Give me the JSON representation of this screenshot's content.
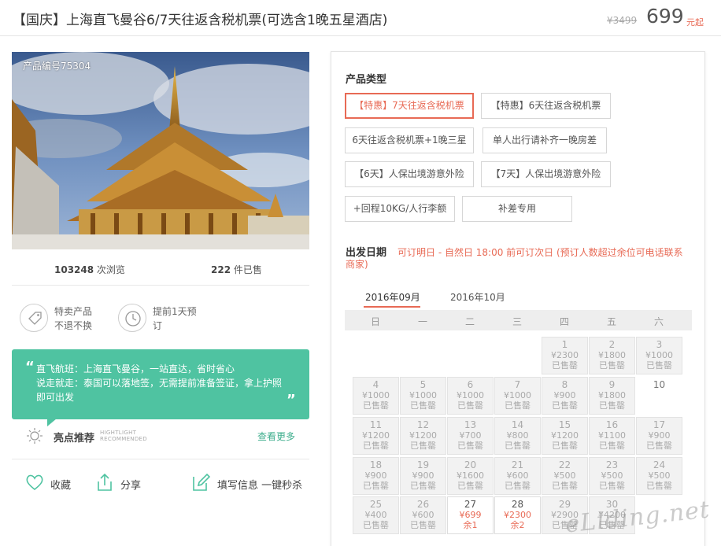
{
  "header": {
    "title": "【国庆】上海直飞曼谷6/7天往返含税机票(可选含1晚五星酒店)",
    "original_price": "¥3499",
    "price": "699",
    "price_unit": "元起"
  },
  "product": {
    "code_label": "产品编号75304",
    "views_count": "103248",
    "views_label": " 次浏览",
    "sold_count": "222",
    "sold_label": " 件已售"
  },
  "features": [
    {
      "icon": "tag-icon",
      "line1": "特卖产品",
      "line2": "不退不换"
    },
    {
      "icon": "clock-icon",
      "line1": "提前1天预",
      "line2": "订"
    }
  ],
  "highlight": {
    "lines": [
      "直飞航班：上海直飞曼谷，一站直达，省时省心",
      "说走就走：泰国可以落地签，无需提前准备签证，拿上护照",
      "即可出发"
    ],
    "label": "亮点推荐",
    "label_en_1": "HIGHTLIGHT",
    "label_en_2": "RECOMMENDED",
    "see_more": "查看更多"
  },
  "actions": {
    "favorite": "收藏",
    "share": "分享",
    "fill_info": "填写信息 一键秒杀"
  },
  "product_types": {
    "title": "产品类型",
    "options": [
      "【特惠】7天往返含税机票",
      "【特惠】6天往返含税机票",
      "6天往返含税机票+1晚三星",
      "单人出行请补齐一晚房差",
      "【6天】人保出境游意外险",
      "【7天】人保出境游意外险",
      "+回程10KG/人行李额",
      "补差专用"
    ],
    "selected_index": 0
  },
  "departure": {
    "label": "出发日期",
    "note": "可订明日 - 自然日 18:00 前可订次日    (预订人数超过余位可电话联系商家)",
    "months": [
      "2016年09月",
      "2016年10月"
    ],
    "active_month": 0,
    "weekdays": [
      "日",
      "一",
      "二",
      "三",
      "四",
      "五",
      "六"
    ],
    "sold_out_label": "已售罄"
  },
  "calendar": [
    [
      null,
      null,
      null,
      null,
      {
        "d": "1",
        "p": "¥2300",
        "s": "已售罄"
      },
      {
        "d": "2",
        "p": "¥1800",
        "s": "已售罄"
      },
      {
        "d": "3",
        "p": "¥1000",
        "s": "已售罄"
      }
    ],
    [
      {
        "d": "4",
        "p": "¥1000",
        "s": "已售罄"
      },
      {
        "d": "5",
        "p": "¥1000",
        "s": "已售罄"
      },
      {
        "d": "6",
        "p": "¥1000",
        "s": "已售罄"
      },
      {
        "d": "7",
        "p": "¥1000",
        "s": "已售罄"
      },
      {
        "d": "8",
        "p": "¥900",
        "s": "已售罄"
      },
      {
        "d": "9",
        "p": "¥1800",
        "s": "已售罄"
      },
      {
        "d": "10",
        "p": "",
        "s": "",
        "plain": true
      }
    ],
    [
      {
        "d": "11",
        "p": "¥1200",
        "s": "已售罄"
      },
      {
        "d": "12",
        "p": "¥1200",
        "s": "已售罄"
      },
      {
        "d": "13",
        "p": "¥700",
        "s": "已售罄"
      },
      {
        "d": "14",
        "p": "¥800",
        "s": "已售罄"
      },
      {
        "d": "15",
        "p": "¥1200",
        "s": "已售罄"
      },
      {
        "d": "16",
        "p": "¥1100",
        "s": "已售罄"
      },
      {
        "d": "17",
        "p": "¥900",
        "s": "已售罄"
      }
    ],
    [
      {
        "d": "18",
        "p": "¥900",
        "s": "已售罄"
      },
      {
        "d": "19",
        "p": "¥900",
        "s": "已售罄"
      },
      {
        "d": "20",
        "p": "¥1600",
        "s": "已售罄"
      },
      {
        "d": "21",
        "p": "¥600",
        "s": "已售罄"
      },
      {
        "d": "22",
        "p": "¥500",
        "s": "已售罄"
      },
      {
        "d": "23",
        "p": "¥500",
        "s": "已售罄"
      },
      {
        "d": "24",
        "p": "¥500",
        "s": "已售罄"
      }
    ],
    [
      {
        "d": "25",
        "p": "¥400",
        "s": "已售罄"
      },
      {
        "d": "26",
        "p": "¥600",
        "s": "已售罄"
      },
      {
        "d": "27",
        "p": "¥699",
        "s": "余1",
        "open": true
      },
      {
        "d": "28",
        "p": "¥2300",
        "s": "余2",
        "open": true
      },
      {
        "d": "29",
        "p": "¥2900",
        "s": "已售罄"
      },
      {
        "d": "30",
        "p": "¥4200",
        "s": "已售罄"
      },
      null
    ]
  ],
  "watermark": "eLiding.net",
  "colors": {
    "accent": "#e86a55",
    "green": "#4fc3a1",
    "link_green": "#3fae8e"
  }
}
